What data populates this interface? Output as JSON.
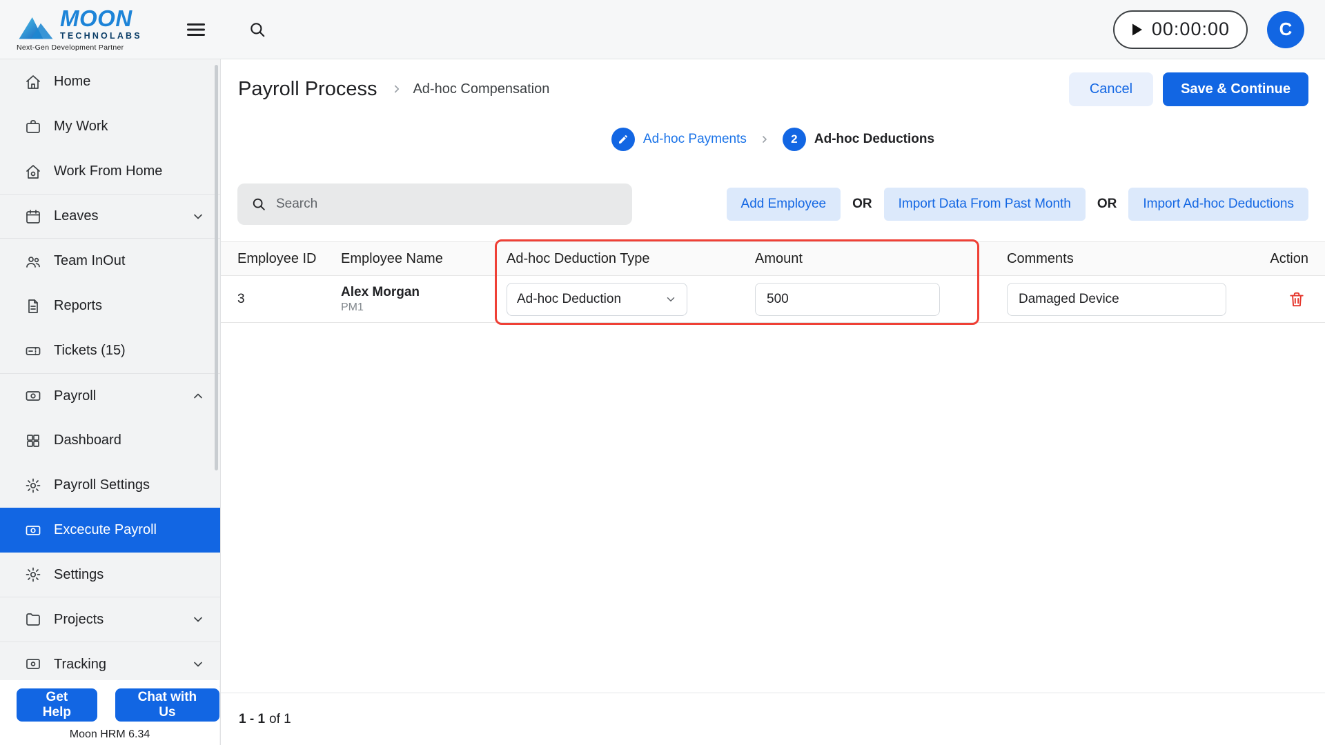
{
  "brand": {
    "name": "MOON",
    "sub": "TECHNOLABS",
    "tagline": "Next-Gen Development Partner",
    "version": "Moon HRM 6.34"
  },
  "topbar": {
    "timer": "00:00:00",
    "avatar_initial": "C"
  },
  "sidebar": {
    "items": [
      {
        "label": "Home"
      },
      {
        "label": "My Work"
      },
      {
        "label": "Work From Home"
      },
      {
        "label": "Leaves"
      },
      {
        "label": "Team InOut"
      },
      {
        "label": "Reports"
      },
      {
        "label": "Tickets (15)"
      },
      {
        "label": "Payroll"
      },
      {
        "label": "Dashboard"
      },
      {
        "label": "Payroll Settings"
      },
      {
        "label": "Excecute Payroll"
      },
      {
        "label": "Settings"
      },
      {
        "label": "Projects"
      },
      {
        "label": "Tracking"
      }
    ],
    "get_help": "Get Help",
    "chat": "Chat with Us"
  },
  "page": {
    "title": "Payroll Process",
    "breadcrumb": "Ad-hoc Compensation",
    "cancel": "Cancel",
    "save": "Save & Continue"
  },
  "stepper": {
    "step1": "Ad-hoc Payments",
    "step2_num": "2",
    "step2": "Ad-hoc Deductions"
  },
  "toolbar": {
    "search_placeholder": "Search",
    "add_employee": "Add Employee",
    "or1": "OR",
    "import_past": "Import Data From Past Month",
    "or2": "OR",
    "import_adhoc": "Import Ad-hoc Deductions"
  },
  "table": {
    "headers": [
      "Employee ID",
      "Employee Name",
      "Ad-hoc Deduction Type",
      "Amount",
      "Comments",
      "Action"
    ],
    "rows": [
      {
        "employee_id": "3",
        "name": "Alex Morgan",
        "role": "PM1",
        "deduction_type": "Ad-hoc Deduction",
        "amount": "500",
        "comments": "Damaged Device"
      }
    ]
  },
  "pagination": {
    "range": "1 - 1",
    "of": "of 1"
  },
  "icons": {
    "moon-logo-icon": "mountain-triangles",
    "menu-icon": "hamburger",
    "search-icon": "magnifier",
    "play-icon": "triangle",
    "home-icon": "house",
    "briefcase-icon": "briefcase",
    "wfh-icon": "house-person",
    "calendar-icon": "calendar",
    "people-icon": "two-people",
    "report-icon": "document",
    "ticket-icon": "ticket",
    "payroll-icon": "card-coin",
    "dashboard-icon": "grid",
    "gear-icon": "gear",
    "folder-icon": "folder",
    "tracking-icon": "monitor-eye",
    "chevron-down-icon": "v",
    "chevron-up-icon": "^",
    "chevron-right-icon": ">",
    "pencil-icon": "pencil",
    "trash-icon": "trash-can"
  },
  "colors": {
    "primary": "#1266e3",
    "light_button_bg": "#dce9fb",
    "stepper_blue": "#1a73e8",
    "annotation_red": "#ef4036",
    "trash_red": "#e5362c"
  }
}
